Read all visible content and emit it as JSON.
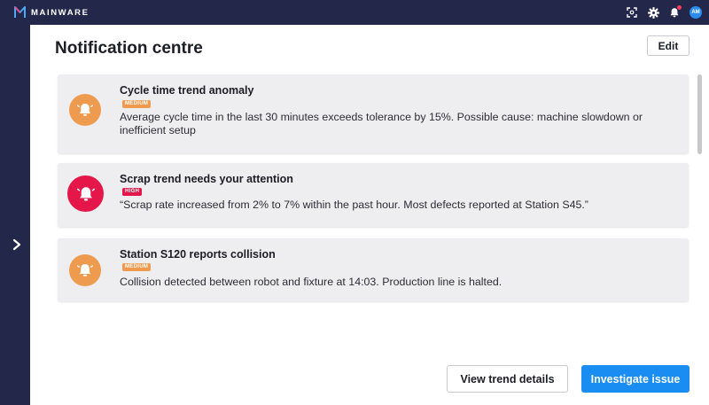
{
  "app": {
    "brand": "MAINWARE"
  },
  "header": {
    "icons": [
      "fullscreen-icon",
      "gear-icon",
      "bell-icon"
    ],
    "avatar_initials": "AM"
  },
  "sidebar": {
    "expand_icon": "chevron-right-icon"
  },
  "page": {
    "title": "Notification centre",
    "edit_label": "Edit"
  },
  "notifications": [
    {
      "title": "Cycle time trend anomaly",
      "severity": "MEDIUM",
      "message": "Average cycle time in the last 30 minutes exceeds tolerance by 15%. Possible cause: machine slowdown or inefficient setup",
      "icon": "bell-icon"
    },
    {
      "title": "Scrap trend needs your attention",
      "severity": "HIGH",
      "message": "“Scrap rate increased from 2% to 7% within the past hour. Most defects reported at Station S45.”",
      "icon": "bell-icon"
    },
    {
      "title": "Station S120 reports collision",
      "severity": "MEDIUM",
      "message": "Collision detected between robot and fixture at 14:03. Production line is halted.",
      "icon": "bell-icon"
    }
  ],
  "actions": {
    "secondary": "View trend details",
    "primary": "Investigate issue"
  },
  "colors": {
    "navy": "#23274a",
    "medium": "#ee9a4f",
    "high": "#e5164a",
    "primary": "#1a8df3",
    "card": "#eeedef"
  }
}
